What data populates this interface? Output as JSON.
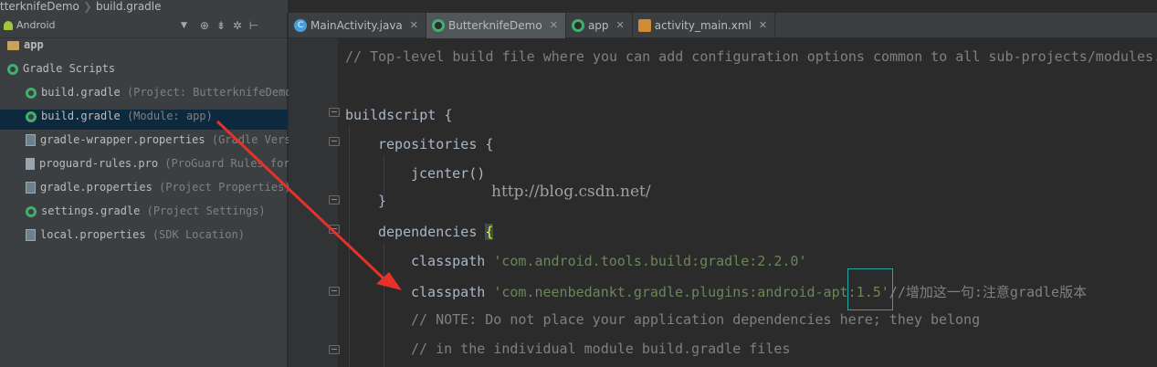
{
  "breadcrumb": {
    "project": "tterknifeDemo",
    "file": "build.gradle"
  },
  "project_panel": {
    "view_name": "Android",
    "toolbar_icons": [
      "target-icon",
      "collapse-icon",
      "gear-icon",
      "pin-icon"
    ],
    "tree": [
      {
        "label": "app",
        "hint": "",
        "icon": "folder-icon"
      },
      {
        "label": "Gradle Scripts",
        "hint": "",
        "icon": "gradle-icon"
      },
      {
        "label": "build.gradle",
        "hint": "(Project: ButterknifeDemo",
        "icon": "gradle-icon"
      },
      {
        "label": "build.gradle",
        "hint": "(Module: app)",
        "icon": "gradle-icon",
        "selected": true
      },
      {
        "label": "gradle-wrapper.properties",
        "hint": "(Gradle Vers",
        "icon": "properties-icon"
      },
      {
        "label": "proguard-rules.pro",
        "hint": "(ProGuard Rules for",
        "icon": "file-icon"
      },
      {
        "label": "gradle.properties",
        "hint": "(Project Properties)",
        "icon": "properties-icon"
      },
      {
        "label": "settings.gradle",
        "hint": "(Project Settings)",
        "icon": "gradle-icon"
      },
      {
        "label": "local.properties",
        "hint": "(SDK Location)",
        "icon": "properties-icon"
      }
    ]
  },
  "tabs": [
    {
      "label": "MainActivity.java",
      "icon": "java-class-icon",
      "close": "✕"
    },
    {
      "label": "ButterknifeDemo",
      "icon": "gradle-icon",
      "close": "✕",
      "active": true
    },
    {
      "label": "app",
      "icon": "gradle-icon",
      "close": "✕"
    },
    {
      "label": "activity_main.xml",
      "icon": "xml-icon",
      "close": "✕"
    }
  ],
  "code": {
    "l1": "// Top-level build file where you can add configuration options common to all sub-projects/modules.",
    "l2": "buildscript {",
    "l3": "repositories {",
    "l4": "jcenter()",
    "l5": "}",
    "l6_kw": "dependencies ",
    "l6_brace": "{",
    "l7_kw": "classpath ",
    "l7_str": "'com.android.tools.build:gradle:2.2.0'",
    "l8_kw": "classpath ",
    "l8_str": "'com.neenbedankt.gradle.plugins:android-apt:1.5'",
    "l8_cm": "//增加这一句:注意gradle版本",
    "l9": "// NOTE: Do not place your application dependencies here; they belong",
    "l10": "// in the individual module build.gradle files"
  },
  "watermark": "http://blog.csdn.net/",
  "colors": {
    "arrow": "#e8312a",
    "selection": "#0d293e",
    "accent_box": "#28a6a6"
  }
}
